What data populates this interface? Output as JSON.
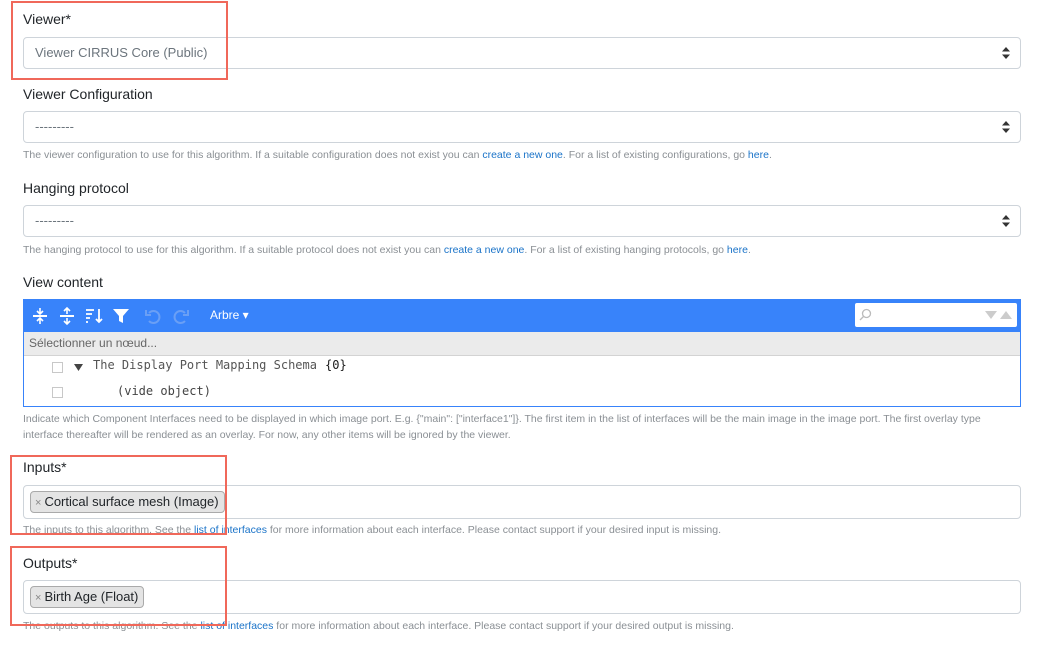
{
  "viewer": {
    "label": "Viewer*",
    "value": "Viewer CIRRUS Core (Public)"
  },
  "viewer_config": {
    "label": "Viewer Configuration",
    "value": "---------",
    "help_pre": "The viewer configuration to use for this algorithm. If a suitable configuration does not exist you can ",
    "help_link1": "create a new one",
    "help_mid": ". For a list of existing configurations, go ",
    "help_link2": "here",
    "help_post": "."
  },
  "hanging_protocol": {
    "label": "Hanging protocol",
    "value": "---------",
    "help_pre": "The hanging protocol to use for this algorithm. If a suitable protocol does not exist you can ",
    "help_link1": "create a new one",
    "help_mid": ". For a list of existing hanging protocols, go ",
    "help_link2": "here",
    "help_post": "."
  },
  "view_content": {
    "label": "View content",
    "mode_label": "Arbre ▾",
    "nav_placeholder": "Sélectionner un nœud...",
    "tree_root": "The Display Port Mapping Schema",
    "tree_root_count": "{0}",
    "tree_child": "(vide object)",
    "help_line1": "Indicate which Component Interfaces need to be displayed in which image port. E.g. {\"main\": [\"interface1\"]}. The first item in the list of interfaces will be the main image in the image port. The first overlay type",
    "help_line2": "interface thereafter will be rendered as an overlay. For now, any other items will be ignored by the viewer."
  },
  "inputs": {
    "label": "Inputs*",
    "tag": "Cortical surface mesh (Image)",
    "tag_remove": "×",
    "help_pre": "The inputs to this algorithm. See the ",
    "help_link": "list of interfaces",
    "help_post": " for more information about each interface. Please contact support if your desired input is missing."
  },
  "outputs": {
    "label": "Outputs*",
    "tag": "Birth Age (Float)",
    "tag_remove": "×",
    "help_pre": "The outputs to this algorithm. See the ",
    "help_link": "list of interfaces",
    "help_post": " for more information about each interface. Please contact support if your desired output is missing."
  },
  "colors": {
    "highlight": "#f0685a",
    "editor_accent": "#3883fa",
    "link": "#1a73c8"
  }
}
